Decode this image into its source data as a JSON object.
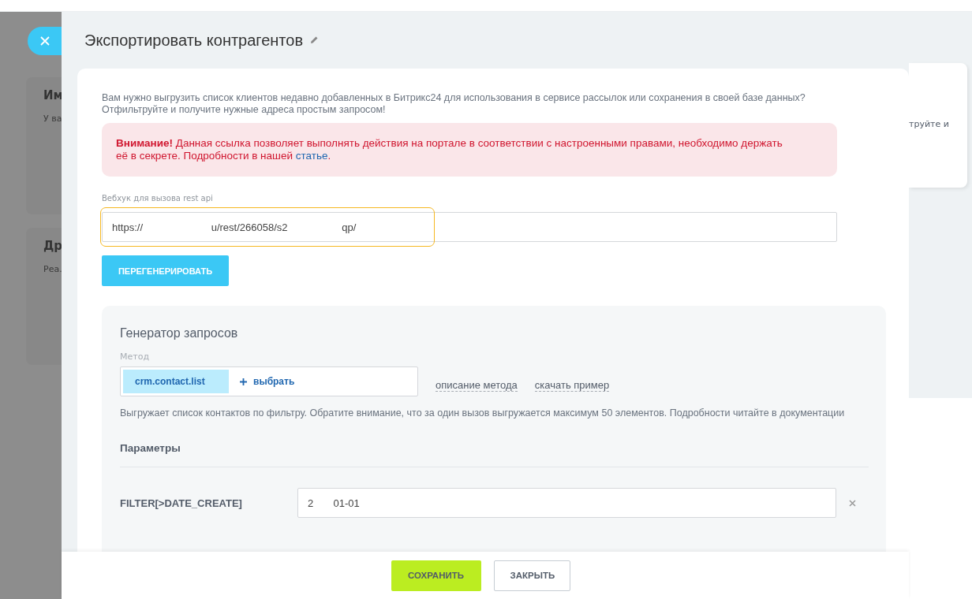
{
  "background": {
    "cards": [
      {
        "title": "Им",
        "text": "У ва"
      },
      {
        "title": "Др",
        "text": "Реа."
      }
    ],
    "right_card_text": "труйте и"
  },
  "panel": {
    "title": "Экспортировать контрагентов",
    "intro": "Вам нужно выгрузить список клиентов недавно добавленных в Битрикс24 для использования в сервисе рассылок или сохранения в своей базе данных? Отфильтруйте и получите нужные адреса простым запросом!",
    "warning": {
      "lead": "Внимание!",
      "text": " Данная ссылка позволяет выполнять действия на портале в соответствии с настроенными правами, необходимо держать её в секрете. Подробности в нашей ",
      "link": "статье",
      "tail": "."
    },
    "webhook": {
      "label": "Вебхук для вызова rest api",
      "value": "https://                        u/rest/266058/s2                   qp/"
    },
    "regenerate_button": "ПЕРЕГЕНЕРИРОВАТЬ",
    "generator": {
      "title": "Генератор запросов",
      "method_label": "Метод",
      "method": "crm.contact.list",
      "choose": "выбрать",
      "links": [
        "описание метода",
        "скачать пример"
      ],
      "description": "Выгружает список контактов по фильтру. Обратите внимание, что за один вызов выгружается максимум 50 элементов. Подробности читайте в документации",
      "params_title": "Параметры",
      "params": [
        {
          "name": "FILTER[>DATE_CREATE]",
          "value": "2       01-01"
        }
      ]
    }
  },
  "footer": {
    "buttons": [
      {
        "label": "СОХРАНИТЬ",
        "kind": "primary"
      },
      {
        "label": "ЗАКРЫТЬ",
        "kind": "secondary"
      }
    ]
  }
}
